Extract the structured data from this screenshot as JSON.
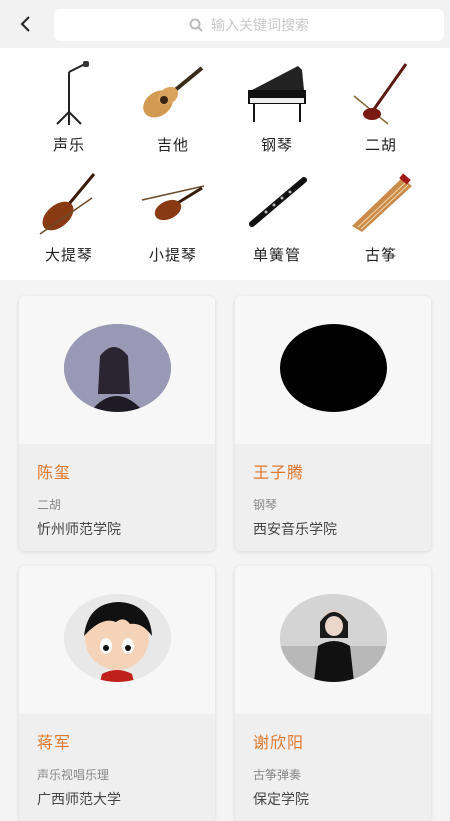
{
  "header": {
    "search_placeholder": "输入关键词搜索"
  },
  "categories": [
    {
      "label": "声乐",
      "icon": "microphone-icon"
    },
    {
      "label": "吉他",
      "icon": "guitar-icon"
    },
    {
      "label": "钢琴",
      "icon": "piano-icon"
    },
    {
      "label": "二胡",
      "icon": "erhu-icon"
    },
    {
      "label": "大提琴",
      "icon": "cello-icon"
    },
    {
      "label": "小提琴",
      "icon": "violin-icon"
    },
    {
      "label": "单簧管",
      "icon": "clarinet-icon"
    },
    {
      "label": "古筝",
      "icon": "guzheng-icon"
    }
  ],
  "teachers": [
    {
      "name": "陈玺",
      "instrument": "二胡",
      "school": "忻州师范学院"
    },
    {
      "name": "王子腾",
      "instrument": "钢琴",
      "school": "西安音乐学院"
    },
    {
      "name": "蒋军",
      "instrument": "声乐视唱乐理",
      "school": "广西师范大学"
    },
    {
      "name": "谢欣阳",
      "instrument": "古筝弹奏",
      "school": "保定学院"
    }
  ],
  "colors": {
    "accent": "#e0782c"
  }
}
